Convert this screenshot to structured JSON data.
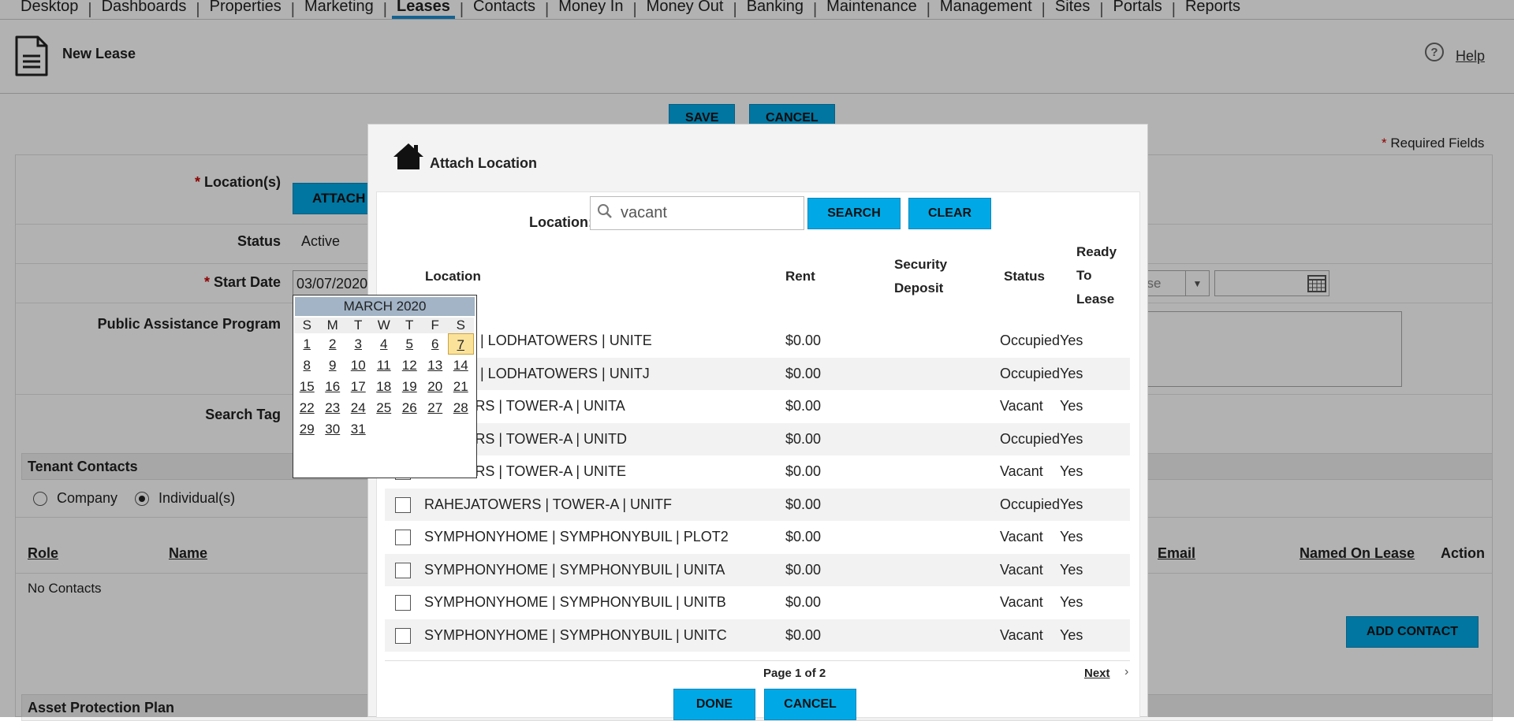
{
  "nav": {
    "items": [
      "Desktop",
      "Dashboards",
      "Properties",
      "Marketing",
      "Leases",
      "Contacts",
      "Money In",
      "Money Out",
      "Banking",
      "Maintenance",
      "Management",
      "Sites",
      "Portals",
      "Reports"
    ],
    "active": "Leases"
  },
  "header": {
    "title": "New Lease",
    "help_label": "Help",
    "help_icon": "question-circle-icon",
    "page_icon": "document-icon"
  },
  "toolbar": {
    "save_label": "SAVE",
    "cancel_label": "CANCEL"
  },
  "form": {
    "required_note": "Required Fields",
    "required_star": "*",
    "location_label": "Location(s)",
    "attach_label": "ATTACH",
    "status_label": "Status",
    "status_value": "Active",
    "start_date_label": "Start Date",
    "start_date_value": "03/07/2020",
    "public_assistance_label": "Public Assistance Program",
    "search_tag_label": "Search Tag",
    "right_select_value": "ose"
  },
  "tenant_contacts": {
    "title": "Tenant Contacts",
    "radio_company": "Company",
    "radio_individuals": "Individual(s)",
    "selected": "Individual(s)",
    "columns": {
      "role": "Role",
      "name": "Name",
      "email": "Email",
      "named_on_lease": "Named On Lease",
      "action": "Action"
    },
    "empty_text": "No Contacts",
    "add_label": "ADD CONTACT"
  },
  "asset_protection": {
    "title": "Asset Protection Plan"
  },
  "calendar": {
    "title": "MARCH 2020",
    "dow": [
      "S",
      "M",
      "T",
      "W",
      "T",
      "F",
      "S"
    ],
    "days": [
      [
        "1",
        "2",
        "3",
        "4",
        "5",
        "6",
        "7"
      ],
      [
        "8",
        "9",
        "10",
        "11",
        "12",
        "13",
        "14"
      ],
      [
        "15",
        "16",
        "17",
        "18",
        "19",
        "20",
        "21"
      ],
      [
        "22",
        "23",
        "24",
        "25",
        "26",
        "27",
        "28"
      ],
      [
        "29",
        "30",
        "31"
      ]
    ],
    "selected_day": "7"
  },
  "modal": {
    "title": "Attach Location",
    "title_icon": "house-icon",
    "search_label": "Location:",
    "search_value": "vacant",
    "search_button": "SEARCH",
    "clear_button": "CLEAR",
    "columns": {
      "location": "Location",
      "rent": "Rent",
      "security_deposit_line1": "Security",
      "security_deposit_line2": "Deposit",
      "status": "Status",
      "ready_line1": "Ready",
      "ready_line2": "To",
      "ready_line3": "Lease"
    },
    "rows": [
      {
        "location": "HOMES | LODHATOWERS | UNITE",
        "rent": "$0.00",
        "deposit": "",
        "status": "Occupied",
        "ready": "Yes"
      },
      {
        "location": "HOMES | LODHATOWERS | UNITJ",
        "rent": "$0.00",
        "deposit": "",
        "status": "Occupied",
        "ready": "Yes"
      },
      {
        "location": "ATOWERS | TOWER-A | UNITA",
        "rent": "$0.00",
        "deposit": "",
        "status": "Vacant",
        "ready": "Yes"
      },
      {
        "location": "ATOWERS | TOWER-A | UNITD",
        "rent": "$0.00",
        "deposit": "",
        "status": "Occupied",
        "ready": "Yes"
      },
      {
        "location": "ATOWERS | TOWER-A | UNITE",
        "rent": "$0.00",
        "deposit": "",
        "status": "Vacant",
        "ready": "Yes"
      },
      {
        "location": "RAHEJATOWERS | TOWER-A | UNITF",
        "rent": "$0.00",
        "deposit": "",
        "status": "Occupied",
        "ready": "Yes"
      },
      {
        "location": "SYMPHONYHOME | SYMPHONYBUIL | PLOT2",
        "rent": "$0.00",
        "deposit": "",
        "status": "Vacant",
        "ready": "Yes"
      },
      {
        "location": "SYMPHONYHOME | SYMPHONYBUIL | UNITA",
        "rent": "$0.00",
        "deposit": "",
        "status": "Vacant",
        "ready": "Yes"
      },
      {
        "location": "SYMPHONYHOME | SYMPHONYBUIL | UNITB",
        "rent": "$0.00",
        "deposit": "",
        "status": "Vacant",
        "ready": "Yes"
      },
      {
        "location": "SYMPHONYHOME | SYMPHONYBUIL | UNITC",
        "rent": "$0.00",
        "deposit": "",
        "status": "Vacant",
        "ready": "Yes"
      }
    ],
    "pager": "Page 1 of 2",
    "next_label": "Next",
    "done_button": "DONE",
    "cancel_button": "CANCEL"
  },
  "colors": {
    "accent": "#00a9e6",
    "active_tab": "#1a8fd1",
    "calendar_header": "#a2b4c6",
    "calendar_today": "#fbe29b"
  }
}
